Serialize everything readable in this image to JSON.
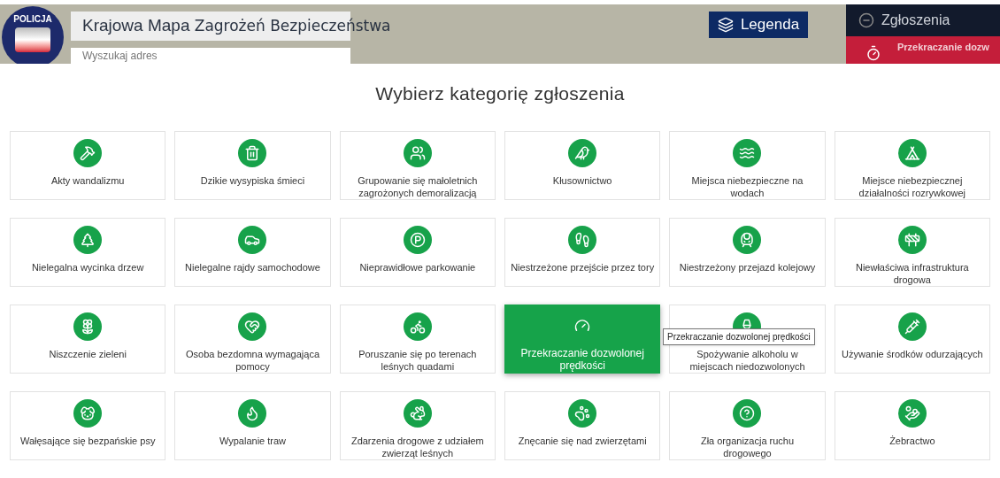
{
  "header": {
    "title_plain": "Krajowa Mapa",
    "title_bold": "Zagrożeń Bezpieczeństwa",
    "logo_text": "POLICJA",
    "search": {
      "placeholder": "Wyszukaj adres"
    },
    "legend_button": "Legenda",
    "reports_panel": {
      "title": "Zgłoszenia",
      "item": "Przekraczanie dozw"
    }
  },
  "dialog": {
    "title": "Wybierz kategorię zgłoszenia",
    "categories": [
      {
        "label": "Akty wandalizmu",
        "selected": false
      },
      {
        "label": "Dzikie wysypiska śmieci",
        "selected": false
      },
      {
        "label": "Grupowanie się małoletnich zagrożonych demoralizacją",
        "selected": false
      },
      {
        "label": "Kłusownictwo",
        "selected": false
      },
      {
        "label": "Miejsca niebezpieczne na wodach",
        "selected": false
      },
      {
        "label": "Miejsce niebezpiecznej działalności rozrywkowej",
        "selected": false
      },
      {
        "label": "Nielegalna wycinka drzew",
        "selected": false
      },
      {
        "label": "Nielegalne rajdy samochodowe",
        "selected": false
      },
      {
        "label": "Nieprawidłowe parkowanie",
        "selected": false
      },
      {
        "label": "Niestrzeżone przejście przez tory",
        "selected": false
      },
      {
        "label": "Niestrzeżony przejazd kolejowy",
        "selected": false
      },
      {
        "label": "Niewłaściwa infrastruktura drogowa",
        "selected": false
      },
      {
        "label": "Niszczenie zieleni",
        "selected": false
      },
      {
        "label": "Osoba bezdomna wymagająca pomocy",
        "selected": false
      },
      {
        "label": "Poruszanie się po terenach leśnych quadami",
        "selected": false
      },
      {
        "label": "Przekraczanie dozwolonej prędkości",
        "selected": true
      },
      {
        "label": "Spożywanie alkoholu w miejscach niedozwolonych",
        "selected": false
      },
      {
        "label": "Używanie środków odurzających",
        "selected": false
      },
      {
        "label": "Wałęsające się bezpańskie psy",
        "selected": false
      },
      {
        "label": "Wypalanie traw",
        "selected": false
      },
      {
        "label": "Zdarzenia drogowe z udziałem zwierząt leśnych",
        "selected": false
      },
      {
        "label": "Znęcanie się nad zwierzętami",
        "selected": false
      },
      {
        "label": "Zła organizacja ruchu drogowego",
        "selected": false
      },
      {
        "label": "Żebractwo",
        "selected": false
      }
    ],
    "tooltip": "Przekraczanie dozwolonej prędkości"
  }
}
